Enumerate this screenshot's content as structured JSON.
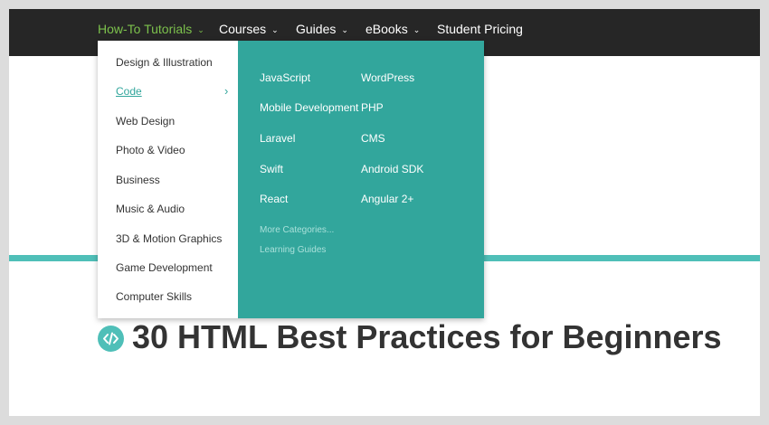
{
  "nav": {
    "items": [
      {
        "label": "How-To Tutorials",
        "has_caret": true,
        "active": true
      },
      {
        "label": "Courses",
        "has_caret": true
      },
      {
        "label": "Guides",
        "has_caret": true
      },
      {
        "label": "eBooks",
        "has_caret": true
      },
      {
        "label": "Student Pricing",
        "has_caret": false
      }
    ],
    "caret_glyph": "⌄"
  },
  "dropdown": {
    "categories": [
      "Design & Illustration",
      "Code",
      "Web Design",
      "Photo & Video",
      "Business",
      "Music & Audio",
      "3D & Motion Graphics",
      "Game Development",
      "Computer Skills"
    ],
    "active_category": "Code",
    "chevron_glyph": "›",
    "subcategories_col1": [
      "JavaScript",
      "Mobile Development",
      "Laravel",
      "Swift",
      "React"
    ],
    "subcategories_col2": [
      "WordPress",
      "PHP",
      "CMS",
      "Android SDK",
      "Angular 2+"
    ],
    "more_categories": "More Categories...",
    "learning_guides": "Learning Guides"
  },
  "article": {
    "icon": "code-icon",
    "title": "30 HTML Best Practices for Beginners"
  },
  "colors": {
    "topbar": "#262626",
    "nav_active": "#7cc14c",
    "teal_panel": "#32a69c",
    "accent_line": "#4fbfb8",
    "title_text": "#333333"
  }
}
